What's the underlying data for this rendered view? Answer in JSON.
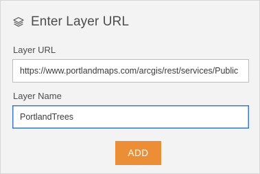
{
  "header": {
    "icon": "layers-icon",
    "title": "Enter Layer URL"
  },
  "form": {
    "layer_url": {
      "label": "Layer URL",
      "value": "https://www.portlandmaps.com/arcgis/rest/services/Public"
    },
    "layer_name": {
      "label": "Layer Name",
      "value": "PortlandTrees"
    },
    "add_button": {
      "label": "ADD"
    }
  },
  "colors": {
    "panel_background": "#f3f3f3",
    "button_accent": "#eb8e35",
    "focus_border": "#3b78c8"
  }
}
